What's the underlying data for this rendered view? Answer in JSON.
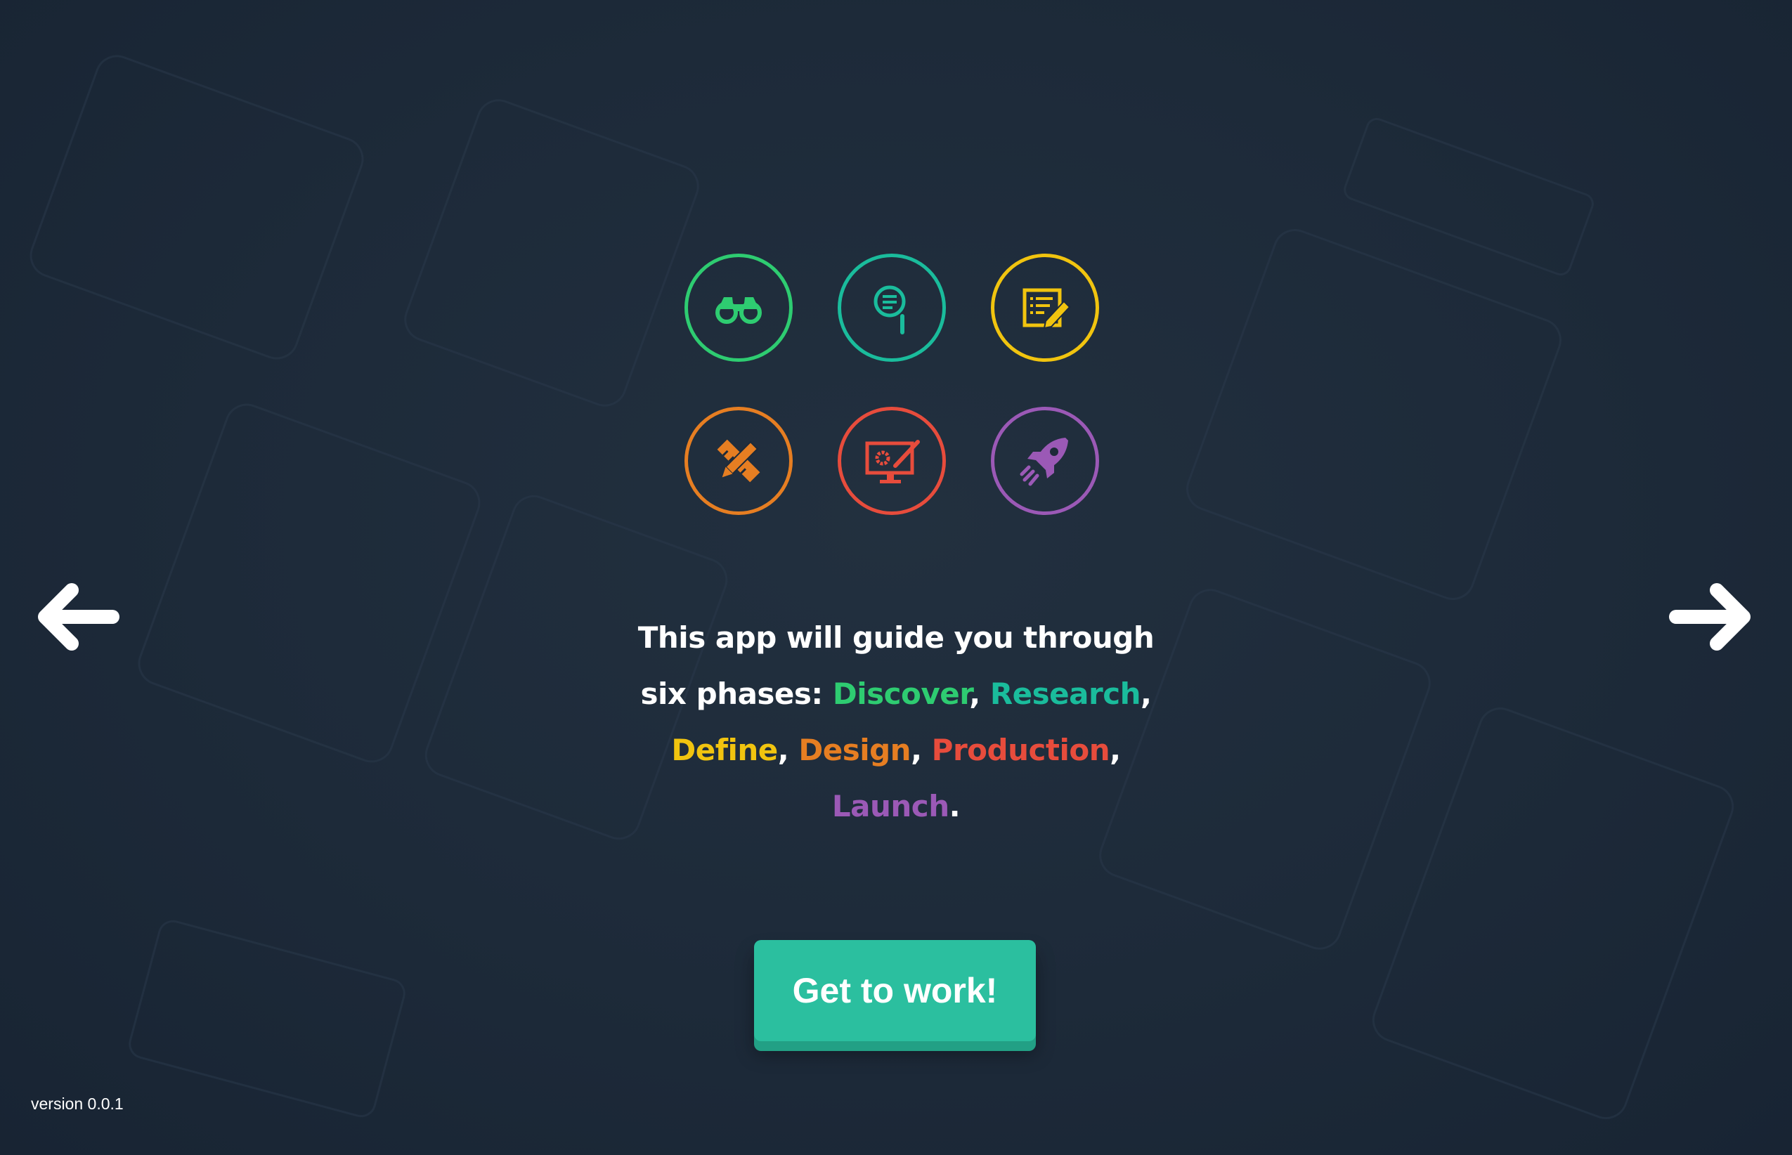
{
  "colors": {
    "discover": "#2ecc71",
    "research": "#1abc9c",
    "define": "#f1c40f",
    "design": "#e67e22",
    "production": "#e74c3c",
    "launch": "#9b59b6",
    "cta": "#2bbf9f"
  },
  "phase_icons": [
    {
      "icon": "binoculars-icon",
      "color": "#2ecc71"
    },
    {
      "icon": "search-document-icon",
      "color": "#1abc9c"
    },
    {
      "icon": "notes-pencil-icon",
      "color": "#f1c40f"
    },
    {
      "icon": "pencil-ruler-icon",
      "color": "#e67e22"
    },
    {
      "icon": "monitor-settings-icon",
      "color": "#e74c3c"
    },
    {
      "icon": "rocket-icon",
      "color": "#9b59b6"
    }
  ],
  "intro": {
    "prefix": "This app will guide you through six phases: ",
    "phases": [
      "Discover",
      "Research",
      "Define",
      "Design",
      "Production",
      "Launch"
    ],
    "separator": ", ",
    "suffix": "."
  },
  "nav": {
    "prev_icon": "arrow-left-icon",
    "next_icon": "arrow-right-icon"
  },
  "cta": {
    "label": "Get to work!"
  },
  "footer": {
    "version": "version 0.0.1"
  }
}
